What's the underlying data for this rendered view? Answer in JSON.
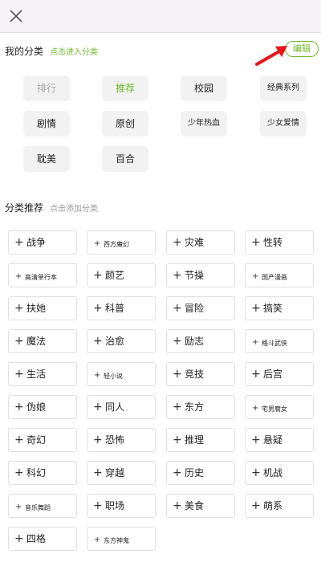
{
  "header": {
    "close_icon": "close-icon"
  },
  "my_categories": {
    "title": "我的分类",
    "hint": "点击进入分类",
    "edit_label": "编辑",
    "items": [
      {
        "label": "排行",
        "state": "muted"
      },
      {
        "label": "推荐",
        "state": "active"
      },
      {
        "label": "校园",
        "state": "normal"
      },
      {
        "label": "经典系列",
        "state": "normal"
      },
      {
        "label": "剧情",
        "state": "normal"
      },
      {
        "label": "原创",
        "state": "normal"
      },
      {
        "label": "少年热血",
        "state": "normal"
      },
      {
        "label": "少女爱情",
        "state": "normal"
      },
      {
        "label": "耽美",
        "state": "normal"
      },
      {
        "label": "百合",
        "state": "normal"
      }
    ]
  },
  "recommended": {
    "title": "分类推荐",
    "hint": "点击添加分类",
    "plus": "+",
    "items": [
      {
        "label": "战争",
        "size": "normal"
      },
      {
        "label": "西方魔幻",
        "size": "small"
      },
      {
        "label": "灾难",
        "size": "normal"
      },
      {
        "label": "性转",
        "size": "normal"
      },
      {
        "label": "高清单行本",
        "size": "small"
      },
      {
        "label": "颜艺",
        "size": "normal"
      },
      {
        "label": "节操",
        "size": "normal"
      },
      {
        "label": "国产漫画",
        "size": "small"
      },
      {
        "label": "扶她",
        "size": "normal"
      },
      {
        "label": "科普",
        "size": "normal"
      },
      {
        "label": "冒险",
        "size": "normal"
      },
      {
        "label": "搞笑",
        "size": "normal"
      },
      {
        "label": "魔法",
        "size": "normal"
      },
      {
        "label": "治愈",
        "size": "normal"
      },
      {
        "label": "励志",
        "size": "normal"
      },
      {
        "label": "格斗武侠",
        "size": "small"
      },
      {
        "label": "生活",
        "size": "normal"
      },
      {
        "label": "轻小说",
        "size": "small"
      },
      {
        "label": "竞技",
        "size": "normal"
      },
      {
        "label": "后宫",
        "size": "normal"
      },
      {
        "label": "伪娘",
        "size": "normal"
      },
      {
        "label": "同人",
        "size": "normal"
      },
      {
        "label": "东方",
        "size": "normal"
      },
      {
        "label": "宅男腐女",
        "size": "small"
      },
      {
        "label": "奇幻",
        "size": "normal"
      },
      {
        "label": "恐怖",
        "size": "normal"
      },
      {
        "label": "推理",
        "size": "normal"
      },
      {
        "label": "悬疑",
        "size": "normal"
      },
      {
        "label": "科幻",
        "size": "normal"
      },
      {
        "label": "穿越",
        "size": "normal"
      },
      {
        "label": "历史",
        "size": "normal"
      },
      {
        "label": "机战",
        "size": "normal"
      },
      {
        "label": "音乐舞蹈",
        "size": "small"
      },
      {
        "label": "职场",
        "size": "normal"
      },
      {
        "label": "美食",
        "size": "normal"
      },
      {
        "label": "萌系",
        "size": "normal"
      },
      {
        "label": "四格",
        "size": "normal"
      },
      {
        "label": "东方神鬼",
        "size": "small"
      }
    ]
  },
  "colors": {
    "accent": "#6fba2c",
    "arrow": "#e8141a"
  }
}
